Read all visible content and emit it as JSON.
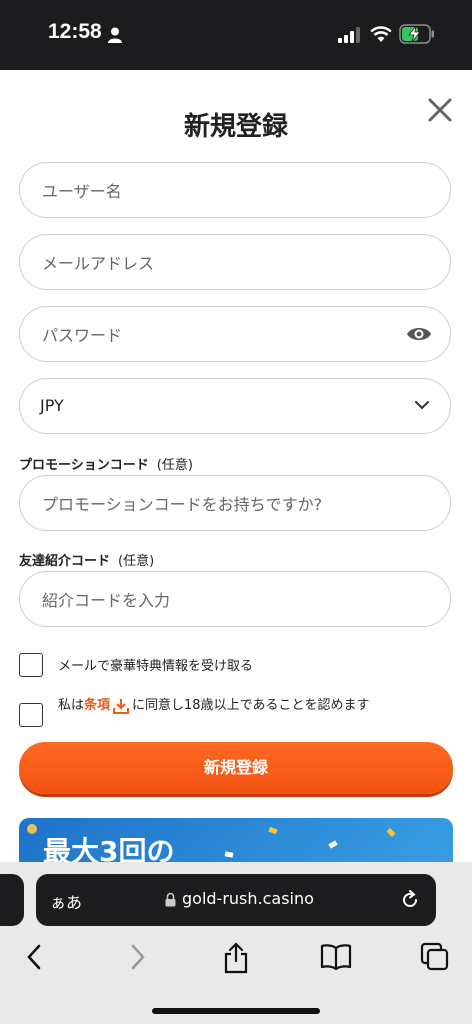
{
  "status_bar": {
    "time": "12:58"
  },
  "dialog": {
    "title": "新規登録",
    "username_placeholder": "ユーザー名",
    "email_placeholder": "メールアドレス",
    "password_placeholder": "パスワード",
    "currency_value": "JPY",
    "promo_label": "プロモーションコード",
    "promo_optional": "(任意)",
    "promo_placeholder": "プロモーションコードをお持ちですか?",
    "referral_label": "友達紹介コード",
    "referral_optional": "(任意)",
    "referral_placeholder": "紹介コードを入力",
    "newsletter_label": "メールで豪華特典情報を受け取る",
    "terms_prefix": "私は",
    "terms_link": "条項",
    "terms_suffix": "に同意し18歳以上であることを認めます",
    "submit_label": "新規登録",
    "promo_banner_text": "最大3回の"
  },
  "browser": {
    "aa_label": "ぁあ",
    "url": "gold-rush.casino"
  },
  "colors": {
    "accent": "#f05a14",
    "banner": "#2a8ad8"
  }
}
